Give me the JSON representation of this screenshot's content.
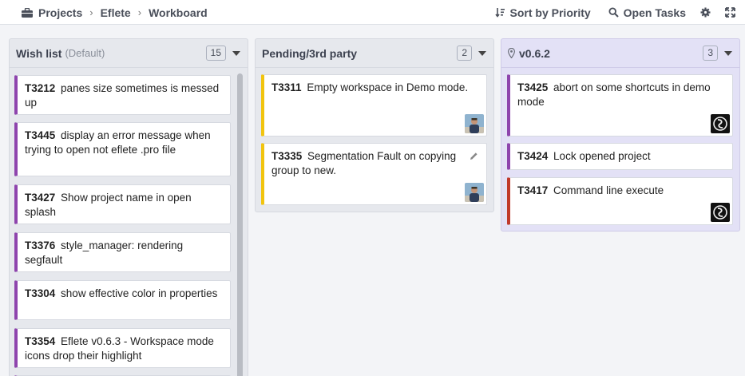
{
  "breadcrumb": {
    "items": [
      "Projects",
      "Eflete",
      "Workboard"
    ]
  },
  "actions": {
    "sort_label": "Sort by Priority",
    "open_tasks_label": "Open Tasks"
  },
  "columns": [
    {
      "title": "Wish list",
      "subtitle": "(Default)",
      "count": "15",
      "color": "#e6e8ed",
      "cards": [
        {
          "id": "T3212",
          "title": "panes size sometimes is messed up",
          "color": "#8e44ad"
        },
        {
          "id": "T3445",
          "title": "display an error message when trying to open not eflete .pro file",
          "color": "#8e44ad"
        },
        {
          "id": "T3427",
          "title": "Show project name in open splash",
          "color": "#8e44ad"
        },
        {
          "id": "T3376",
          "title": "style_manager: rendering segfault",
          "color": "#8e44ad"
        },
        {
          "id": "T3304",
          "title": "show effective color in properties",
          "color": "#8e44ad"
        },
        {
          "id": "T3354",
          "title": "Eflete v0.6.3 - Workspace mode icons drop their highlight",
          "color": "#8e44ad"
        }
      ]
    },
    {
      "title": "Pending/3rd party",
      "count": "2",
      "color": "#e6e8ed",
      "cards": [
        {
          "id": "T3311",
          "title": "Empty workspace in Demo mode.",
          "color": "#f1c40f"
        },
        {
          "id": "T3335",
          "title": "Segmentation Fault on copying group to new.",
          "color": "#f1c40f"
        }
      ]
    },
    {
      "title": "v0.6.2",
      "count": "3",
      "color": "#e3e1f6",
      "cards": [
        {
          "id": "T3425",
          "title": "abort on some shortcuts in demo mode",
          "color": "#8e44ad"
        },
        {
          "id": "T3424",
          "title": "Lock opened project",
          "color": "#8e44ad"
        },
        {
          "id": "T3417",
          "title": "Command line execute",
          "color": "#c0392b"
        }
      ]
    }
  ],
  "icons": [
    "briefcase-icon",
    "chevron-right-icon",
    "sort-icon",
    "search-icon",
    "gear-icon",
    "expand-icon",
    "pin-icon",
    "pencil-icon"
  ]
}
